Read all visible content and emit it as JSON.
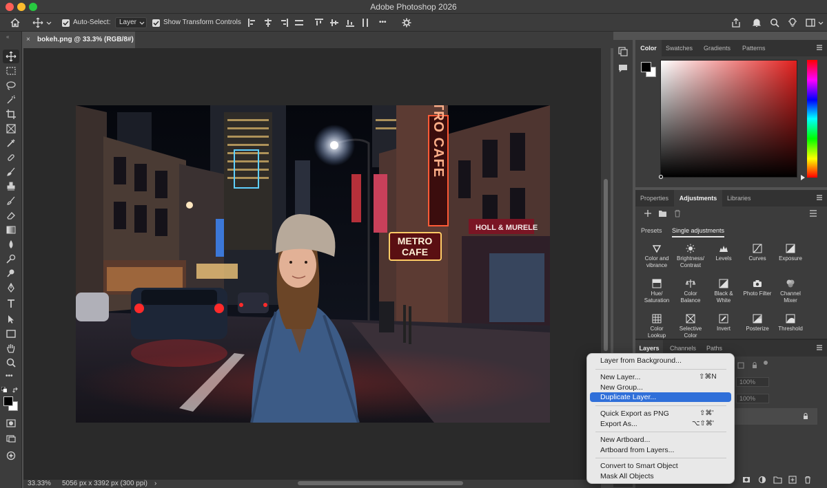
{
  "app": {
    "title": "Adobe Photoshop 2026"
  },
  "options_bar": {
    "auto_select_label": "Auto-Select:",
    "auto_select_target": "Layer",
    "show_transform_label": "Show Transform Controls",
    "more_label": "•••"
  },
  "document": {
    "tab_label": "bokeh.png @ 33.3% (RGB/8#)",
    "close_glyph": "×",
    "zoom": "33.33%",
    "dimensions": "5056 px x 3392 px (300 ppi)",
    "status_arrow": "›"
  },
  "photo_signs": {
    "vertical_sign": "METRO CAFE",
    "marquee_top": "METRO",
    "marquee_bottom": "CAFE",
    "shop_sign": "HOLL & MURELE"
  },
  "color_panel": {
    "tabs": [
      "Color",
      "Swatches",
      "Gradients",
      "Patterns"
    ],
    "active_tab": "Color",
    "foreground": "#000000",
    "background": "#ffffff",
    "hue_color": "#e1201e"
  },
  "adjustments_panel": {
    "tabs": [
      "Properties",
      "Adjustments",
      "Libraries"
    ],
    "active_tab": "Adjustments",
    "subtabs": [
      "Presets",
      "Single adjustments"
    ],
    "active_subtab": "Single adjustments",
    "items": [
      {
        "l1": "Color and",
        "l2": "vibrance",
        "icon": "triangle-down-icon"
      },
      {
        "l1": "Brightness/",
        "l2": "Contrast",
        "icon": "sun-icon"
      },
      {
        "l1": "Levels",
        "l2": "",
        "icon": "levels-icon"
      },
      {
        "l1": "Curves",
        "l2": "",
        "icon": "curves-icon"
      },
      {
        "l1": "Exposure",
        "l2": "",
        "icon": "exposure-icon"
      },
      {
        "l1": "Hue/",
        "l2": "Saturation",
        "icon": "hue-saturation-icon"
      },
      {
        "l1": "Color",
        "l2": "Balance",
        "icon": "balance-icon"
      },
      {
        "l1": "Black &",
        "l2": "White",
        "icon": "black-white-icon"
      },
      {
        "l1": "Photo Filter",
        "l2": "",
        "icon": "camera-icon"
      },
      {
        "l1": "Channel",
        "l2": "Mixer",
        "icon": "channel-mixer-icon"
      },
      {
        "l1": "Color",
        "l2": "Lookup",
        "icon": "grid-icon"
      },
      {
        "l1": "Selective",
        "l2": "Color",
        "icon": "selective-color-icon"
      },
      {
        "l1": "Invert",
        "l2": "",
        "icon": "invert-icon"
      },
      {
        "l1": "Posterize",
        "l2": "",
        "icon": "posterize-icon"
      },
      {
        "l1": "Threshold",
        "l2": "",
        "icon": "threshold-icon"
      }
    ]
  },
  "layers_panel": {
    "tabs": [
      "Layers",
      "Channels",
      "Paths"
    ],
    "active_tab": "Layers",
    "opacity": "100%",
    "fill": "100%"
  },
  "context_menu": {
    "items": [
      {
        "label": "Layer from Background...",
        "shortcut": ""
      },
      {
        "label": "New Layer...",
        "shortcut": "⇧⌘N"
      },
      {
        "label": "New Group...",
        "shortcut": ""
      },
      {
        "label": "Duplicate Layer...",
        "shortcut": ""
      },
      {
        "label": "Quick Export as PNG",
        "shortcut": "⇧⌘'"
      },
      {
        "label": "Export As...",
        "shortcut": "⌥⇧⌘'"
      },
      {
        "label": "New Artboard...",
        "shortcut": ""
      },
      {
        "label": "Artboard from Layers...",
        "shortcut": ""
      },
      {
        "label": "Convert to Smart Object",
        "shortcut": ""
      },
      {
        "label": "Mask All Objects",
        "shortcut": ""
      }
    ],
    "highlighted": "Duplicate Layer..."
  }
}
